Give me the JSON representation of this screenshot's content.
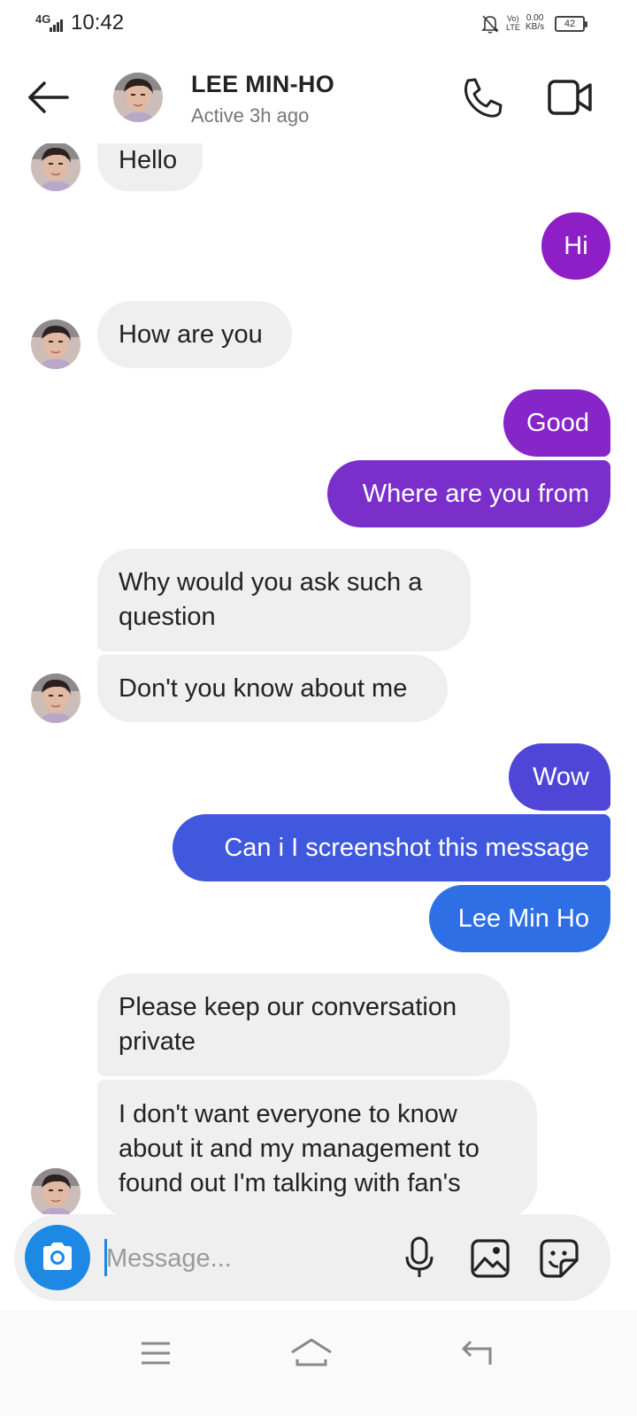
{
  "status_bar": {
    "network": "4G",
    "time": "10:42",
    "volte": [
      "Vo)",
      "LTE"
    ],
    "speed": [
      "0.00",
      "KB/s"
    ],
    "battery": "42",
    "icons": [
      "signal-icon",
      "bell-off-icon",
      "battery-icon"
    ]
  },
  "header": {
    "name": "LEE MIN-HO",
    "status": "Active 3h ago",
    "icons": [
      "back-arrow-icon",
      "phone-icon",
      "video-camera-icon"
    ]
  },
  "messages": [
    {
      "from": "them",
      "text": "Hello"
    },
    {
      "from": "me",
      "text": "Hi"
    },
    {
      "from": "them",
      "text": "How are you"
    },
    {
      "from": "me",
      "text": "Good"
    },
    {
      "from": "me",
      "text": "Where are you from"
    },
    {
      "from": "them",
      "text": "Why would you ask such a question"
    },
    {
      "from": "them",
      "text": "Don't you know about me"
    },
    {
      "from": "me",
      "text": "Wow"
    },
    {
      "from": "me",
      "text": "Can i I screenshot this message"
    },
    {
      "from": "me",
      "text": "Lee Min Ho"
    },
    {
      "from": "them",
      "text": "Please keep our conversation private"
    },
    {
      "from": "them",
      "text": "I don't want everyone to know about it and my management to found out I'm talking with fan's"
    }
  ],
  "composer": {
    "placeholder": "Message...",
    "value": "",
    "icons": [
      "camera-icon",
      "microphone-icon",
      "image-icon",
      "sticker-icon"
    ]
  },
  "navigation": {
    "icons": [
      "menu-icon",
      "home-icon",
      "back-icon"
    ]
  },
  "colors": {
    "incoming_bubble": "#efefef",
    "outgoing_gradient_top": "#8e1ec6",
    "outgoing_gradient_bottom": "#2f6fe6",
    "camera_button": "#1e88e5"
  }
}
